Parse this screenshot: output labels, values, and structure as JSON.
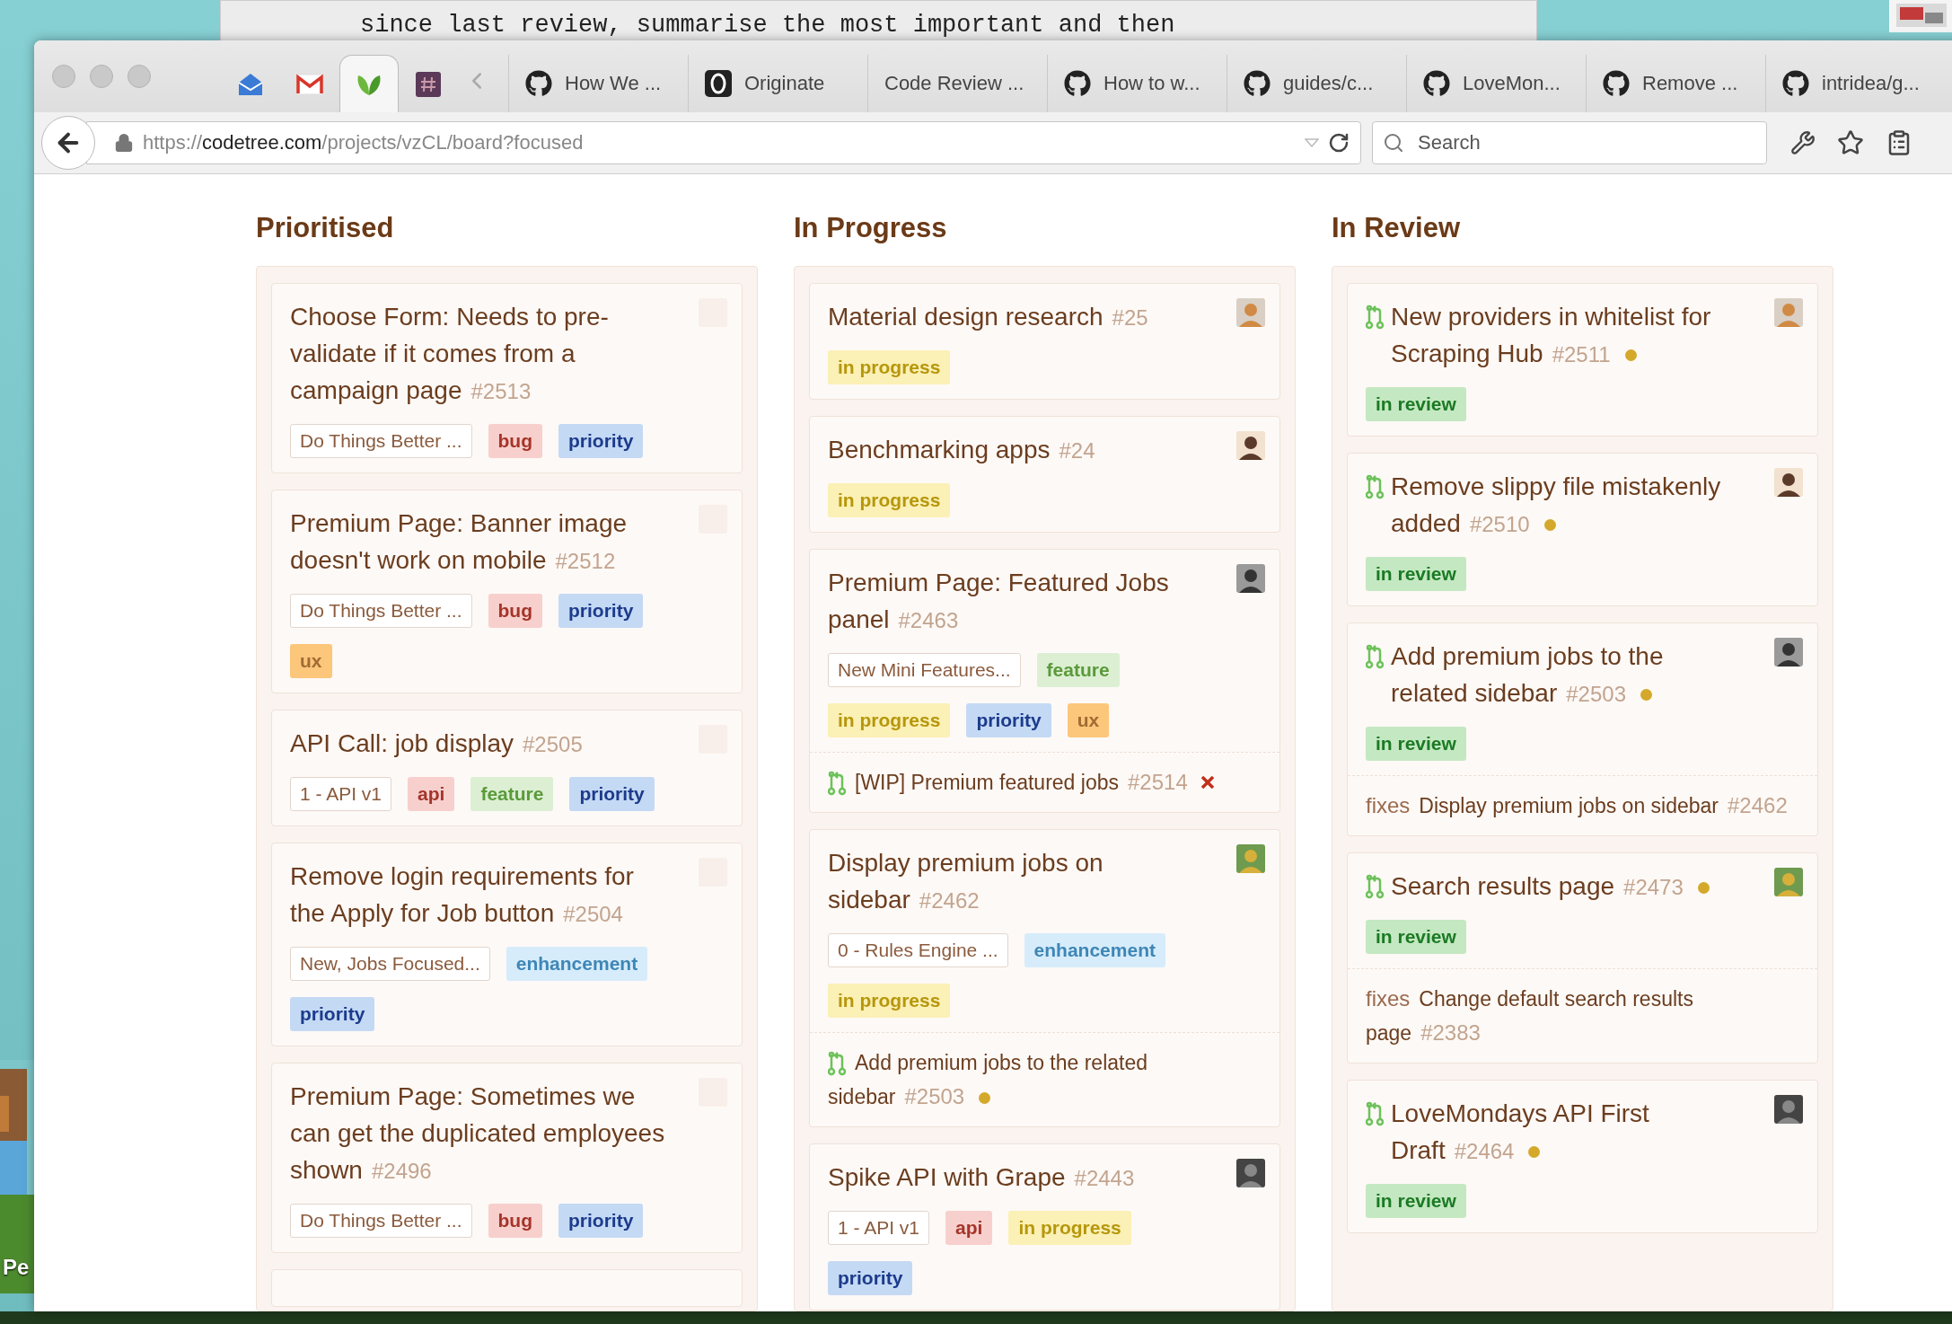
{
  "terminal": {
    "text": "since last review, summarise the most important and then"
  },
  "desktop": {
    "label": "Pe"
  },
  "browser": {
    "pinned_tabs": [
      {
        "selected": false
      },
      {
        "selected": false
      },
      {
        "selected": true
      },
      {
        "selected": false
      }
    ],
    "tabs": [
      {
        "label": "How We ...",
        "kind": "github"
      },
      {
        "label": "Originate",
        "kind": "ring"
      },
      {
        "label": "Code Review ...",
        "kind": "plain"
      },
      {
        "label": "How to w...",
        "kind": "github"
      },
      {
        "label": "guides/c...",
        "kind": "github"
      },
      {
        "label": "LoveMon...",
        "kind": "github"
      },
      {
        "label": "Remove ...",
        "kind": "github"
      },
      {
        "label": "intridea/g...",
        "kind": "github"
      }
    ],
    "url": {
      "scheme": "https://",
      "host": "codetree.com",
      "path": "/projects/vzCL/board?focused"
    },
    "search": {
      "placeholder": "Search"
    }
  },
  "columns": [
    {
      "title": "Prioritised",
      "cards": [
        {
          "kind": "issue",
          "title": "Choose Form: Needs to pre-validate if it comes from a campaign page",
          "number": "#2513",
          "avatar": {
            "kind": "empty"
          },
          "labels": [
            {
              "text": "Do Things Better ...",
              "kind": "milestone"
            },
            {
              "text": "bug",
              "kind": "bug"
            },
            {
              "text": "priority",
              "kind": "priority"
            }
          ]
        },
        {
          "kind": "issue",
          "title": "Premium Page: Banner image doesn't work on mobile",
          "number": "#2512",
          "avatar": {
            "kind": "empty"
          },
          "labels": [
            {
              "text": "Do Things Better ...",
              "kind": "milestone"
            },
            {
              "text": "bug",
              "kind": "bug"
            },
            {
              "text": "priority",
              "kind": "priority"
            },
            {
              "text": "ux",
              "kind": "ux"
            }
          ]
        },
        {
          "kind": "issue",
          "title": "API Call: job display",
          "number": "#2505",
          "avatar": {
            "kind": "empty"
          },
          "labels": [
            {
              "text": "1 - API v1",
              "kind": "milestone"
            },
            {
              "text": "api",
              "kind": "bug"
            },
            {
              "text": "feature",
              "kind": "feature"
            },
            {
              "text": "priority",
              "kind": "priority"
            }
          ]
        },
        {
          "kind": "issue",
          "title": "Remove login requirements for the Apply for Job button",
          "number": "#2504",
          "avatar": {
            "kind": "empty"
          },
          "labels": [
            {
              "text": "New, Jobs Focused...",
              "kind": "milestone"
            },
            {
              "text": "enhancement",
              "kind": "enhancement"
            },
            {
              "text": "priority",
              "kind": "priority"
            }
          ]
        },
        {
          "kind": "issue",
          "title": "Premium Page: Sometimes we can get the duplicated employees shown",
          "number": "#2496",
          "avatar": {
            "kind": "empty"
          },
          "labels": [
            {
              "text": "Do Things Better ...",
              "kind": "milestone"
            },
            {
              "text": "bug",
              "kind": "bug"
            },
            {
              "text": "priority",
              "kind": "priority"
            }
          ]
        },
        {
          "kind": "partial"
        }
      ]
    },
    {
      "title": "In Progress",
      "cards": [
        {
          "kind": "issue",
          "title": "Material design research",
          "number": "#25",
          "avatar": {
            "kind": "picture"
          },
          "labels": [
            {
              "text": "in progress",
              "kind": "progress"
            }
          ]
        },
        {
          "kind": "issue",
          "title": "Benchmarking apps",
          "number": "#24",
          "avatar": {
            "kind": "picture"
          },
          "labels": [
            {
              "text": "in progress",
              "kind": "progress"
            }
          ]
        },
        {
          "kind": "issue",
          "title": "Premium Page: Featured Jobs panel",
          "number": "#2463",
          "avatar": {
            "kind": "picture"
          },
          "labels": [
            {
              "text": "New Mini Features...",
              "kind": "milestone"
            },
            {
              "text": "feature",
              "kind": "feature"
            },
            {
              "text": "in progress",
              "kind": "progress"
            },
            {
              "text": "priority",
              "kind": "priority"
            },
            {
              "text": "ux",
              "kind": "ux"
            }
          ],
          "linked": {
            "kind": "pull_request",
            "title": "[WIP] Premium featured jobs",
            "number": "#2514",
            "failed": true
          }
        },
        {
          "kind": "issue",
          "title": "Display premium jobs on sidebar",
          "number": "#2462",
          "avatar": {
            "kind": "picture"
          },
          "labels": [
            {
              "text": "0 - Rules Engine ...",
              "kind": "milestone"
            },
            {
              "text": "enhancement",
              "kind": "enhancement"
            },
            {
              "text": "in progress",
              "kind": "progress"
            }
          ],
          "linked": {
            "kind": "pull_request",
            "title": "Add premium jobs to the related sidebar",
            "number": "#2503",
            "pending": true
          }
        },
        {
          "kind": "issue",
          "title": "Spike API with Grape",
          "number": "#2443",
          "avatar": {
            "kind": "picture"
          },
          "labels": [
            {
              "text": "1 - API v1",
              "kind": "milestone"
            },
            {
              "text": "api",
              "kind": "bug"
            },
            {
              "text": "in progress",
              "kind": "progress"
            },
            {
              "text": "priority",
              "kind": "priority"
            }
          ]
        }
      ]
    },
    {
      "title": "In Review",
      "cards": [
        {
          "kind": "pull_request",
          "title": "New providers in whitelist for Scraping Hub",
          "number": "#2511",
          "pending": true,
          "avatar": {
            "kind": "picture"
          },
          "labels": [
            {
              "text": "in review",
              "kind": "review"
            }
          ]
        },
        {
          "kind": "pull_request",
          "title": "Remove slippy file mistakenly added",
          "number": "#2510",
          "pending": true,
          "avatar": {
            "kind": "picture"
          },
          "labels": [
            {
              "text": "in review",
              "kind": "review"
            }
          ]
        },
        {
          "kind": "pull_request",
          "title": "Add premium jobs to the related sidebar",
          "number": "#2503",
          "pending": true,
          "avatar": {
            "kind": "picture"
          },
          "labels": [
            {
              "text": "in review",
              "kind": "review"
            }
          ],
          "linked": {
            "kind": "fixes",
            "verb": "fixes",
            "title": "Display premium jobs on sidebar",
            "number": "#2462"
          }
        },
        {
          "kind": "pull_request",
          "title": "Search results page",
          "number": "#2473",
          "pending": true,
          "avatar": {
            "kind": "picture"
          },
          "labels": [
            {
              "text": "in review",
              "kind": "review"
            }
          ],
          "linked": {
            "kind": "fixes",
            "verb": "fixes",
            "title": "Change default search results page",
            "number": "#2383"
          }
        },
        {
          "kind": "pull_request",
          "title": "LoveMondays API First Draft",
          "number": "#2464",
          "pending": true,
          "avatar": {
            "kind": "picture"
          },
          "labels": [
            {
              "text": "in review",
              "kind": "review"
            }
          ]
        }
      ]
    }
  ]
}
